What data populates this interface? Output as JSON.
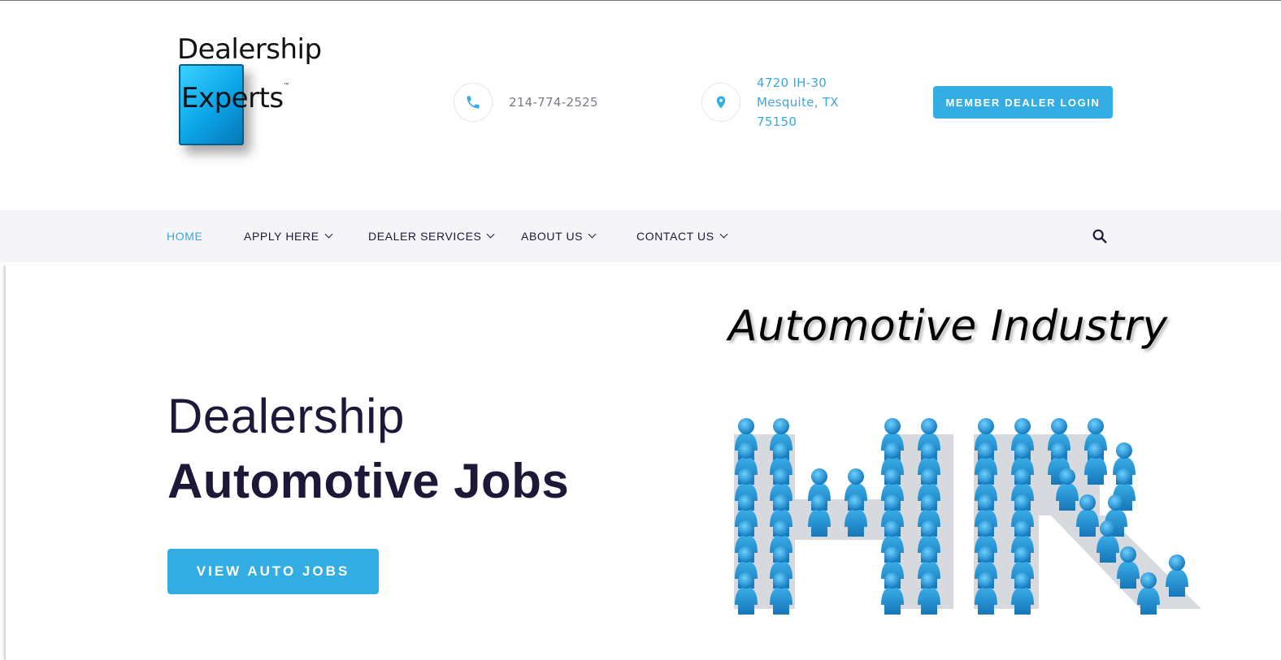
{
  "header": {
    "logo": {
      "line1": "Dealership",
      "line2": "Experts",
      "tm": "™"
    },
    "phone": {
      "icon": "phone-icon",
      "text": "214-774-2525"
    },
    "address": {
      "icon": "location-pin-icon",
      "lines": [
        "4720 IH-30",
        "Mesquite, TX",
        "75150"
      ]
    },
    "login_button": "MEMBER DEALER LOGIN"
  },
  "nav": {
    "items": [
      {
        "label": "HOME",
        "active": true,
        "dropdown": false
      },
      {
        "label": "APPLY HERE",
        "active": false,
        "dropdown": true
      },
      {
        "label": "DEALER SERVICES",
        "active": false,
        "dropdown": true
      },
      {
        "label": "ABOUT US",
        "active": false,
        "dropdown": true
      },
      {
        "label": "CONTACT US",
        "active": false,
        "dropdown": true
      }
    ],
    "search_icon": "search-icon"
  },
  "hero": {
    "line1": "Dealership",
    "line2": "Automotive Jobs",
    "button": "VIEW AUTO JOBS",
    "image_title": "Automotive Industry",
    "image_subject": "HR"
  },
  "colors": {
    "accent": "#33ade3",
    "dark": "#1d1838",
    "nav_bg": "#f5f5f9",
    "muted_text": "#7a7a85"
  }
}
